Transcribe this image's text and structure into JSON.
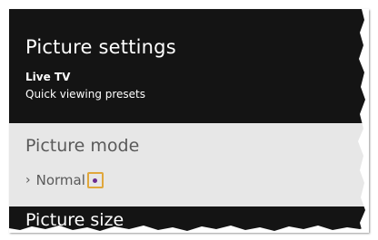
{
  "header": {
    "title": "Picture settings",
    "source": "Live TV",
    "subtitle": "Quick viewing presets"
  },
  "menu": {
    "items": [
      {
        "label": "Picture mode",
        "value": "Normal",
        "selected": true
      },
      {
        "label": "Picture size"
      }
    ]
  },
  "colors": {
    "background": "#141414",
    "selected_row": "#e7e7e7",
    "highlight_border": "#e0a73c",
    "indicator": "#6a2c91"
  },
  "icons": {
    "chevron": "chevron-right-icon",
    "indicator": "star-indicator-icon"
  }
}
